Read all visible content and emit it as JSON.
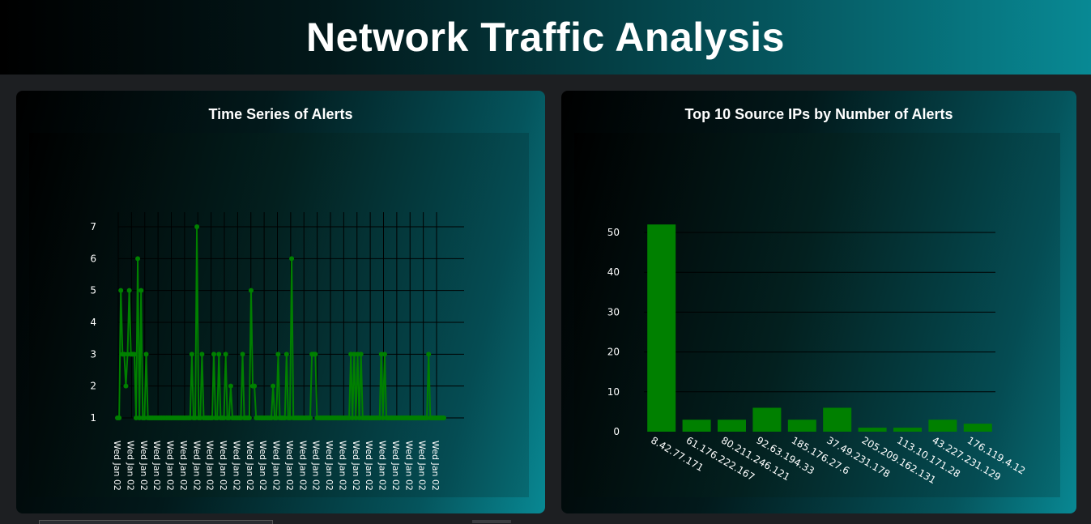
{
  "header": {
    "title": "Network Traffic Analysis"
  },
  "colors": {
    "accent": "#008000",
    "teal": "#088994",
    "grid": "#000000"
  },
  "chart_data": [
    {
      "type": "line",
      "title": "Time Series of Alerts",
      "xlabel": "",
      "ylabel": "",
      "ylim": [
        1,
        7
      ],
      "yticks": [
        1,
        2,
        3,
        4,
        5,
        6,
        7
      ],
      "x_tick_labels": [
        "Wed Jan 02",
        "Wed Jan 02",
        "Wed Jan 02",
        "Wed Jan 02",
        "Wed Jan 02",
        "Wed Jan 02",
        "Wed Jan 02",
        "Wed Jan 02",
        "Wed Jan 02",
        "Wed Jan 02",
        "Wed Jan 02",
        "Wed Jan 02",
        "Wed Jan 02",
        "Wed Jan 02",
        "Wed Jan 02",
        "Wed Jan 02",
        "Wed Jan 02",
        "Wed Jan 02",
        "Wed Jan 02",
        "Wed Jan 02",
        "Wed Jan 02",
        "Wed Jan 02",
        "Wed Jan 02",
        "Wed Jan 02",
        "Wed Jan 02"
      ],
      "series": [
        {
          "values": [
            1,
            1,
            5,
            3,
            3,
            2,
            3,
            5,
            3,
            3,
            3,
            1,
            6,
            1,
            5,
            1,
            1,
            3,
            1,
            1,
            1,
            1,
            1,
            1,
            1,
            1,
            1,
            1,
            1,
            1,
            1,
            1,
            1,
            1,
            1,
            1,
            1,
            1,
            1,
            1,
            1,
            1,
            1,
            1,
            3,
            1,
            1,
            7,
            1,
            1,
            3,
            1,
            1,
            1,
            1,
            1,
            1,
            3,
            1,
            1,
            3,
            1,
            1,
            1,
            3,
            1,
            1,
            2,
            1,
            1,
            1,
            1,
            1,
            1,
            3,
            1,
            1,
            1,
            1,
            5,
            2,
            2,
            1,
            1,
            1,
            1,
            1,
            1,
            1,
            1,
            1,
            1,
            2,
            1,
            1,
            3,
            1,
            1,
            1,
            1,
            3,
            1,
            1,
            6,
            1,
            1,
            1,
            1,
            1,
            1,
            1,
            1,
            1,
            1,
            1,
            3,
            3,
            3,
            1,
            1,
            1,
            1,
            1,
            1,
            1,
            1,
            1,
            1,
            1,
            1,
            1,
            1,
            1,
            1,
            1,
            1,
            1,
            1,
            3,
            1,
            3,
            1,
            3,
            1,
            3,
            1,
            1,
            1,
            1,
            1,
            1,
            1,
            1,
            1,
            1,
            1,
            3,
            1,
            3,
            1,
            1,
            1,
            1,
            1,
            1,
            1,
            1,
            1,
            1,
            1,
            1,
            1,
            1,
            1,
            1,
            1,
            1,
            1,
            1,
            1,
            1,
            1,
            1,
            1,
            3,
            1,
            1,
            1,
            1,
            1,
            1,
            1,
            1,
            1
          ]
        }
      ],
      "grid": true
    },
    {
      "type": "bar",
      "title": "Top 10 Source IPs by Number of Alerts",
      "xlabel": "",
      "ylabel": "",
      "ylim": [
        0,
        53
      ],
      "yticks": [
        0,
        10,
        20,
        30,
        40,
        50
      ],
      "categories": [
        "8.42.77.171",
        "61.176.222.167",
        "80.211.246.121",
        "92.63.194.33",
        "185.176.27.6",
        "37.49.231.178",
        "205.209.162.131",
        "113.10.171.28",
        "43.227.231.129",
        "176.119.4.12"
      ],
      "values": [
        52,
        3,
        3,
        6,
        3,
        6,
        1,
        1,
        3,
        2
      ],
      "grid": true
    }
  ]
}
